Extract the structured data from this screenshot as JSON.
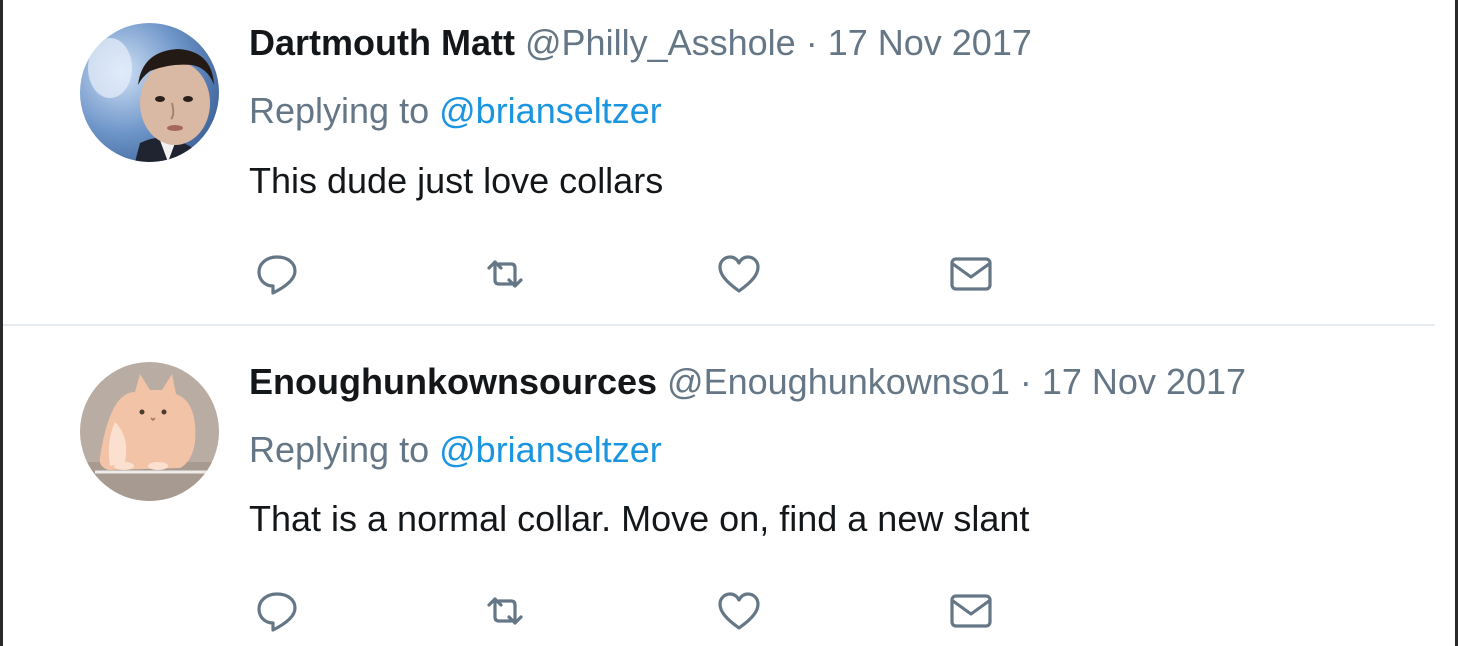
{
  "tweets": [
    {
      "name": "Dartmouth Matt",
      "handle": "@Philly_Asshole",
      "separator": "·",
      "date": "17 Nov 2017",
      "replying_prefix": "Replying to",
      "replying_to": "@brianseltzer",
      "text": "This dude just love collars",
      "avatar": "person-photo-avatar"
    },
    {
      "name": "Enoughunkownsources",
      "handle": "@Enoughunkownso1",
      "separator": "·",
      "date": "17 Nov 2017",
      "replying_prefix": "Replying to",
      "replying_to": "@brianseltzer",
      "text": "That is a normal collar. Move on, find a new slant",
      "avatar": "cat-illustration-avatar"
    }
  ],
  "actions": [
    "reply-icon",
    "retweet-icon",
    "like-icon",
    "direct-message-icon"
  ],
  "colors": {
    "text_primary": "#14171a",
    "text_secondary": "#657786",
    "link": "#1b95e0",
    "divider": "#e6ecf0"
  }
}
